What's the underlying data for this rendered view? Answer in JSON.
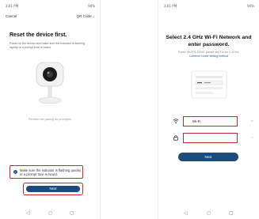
{
  "left_screen": {
    "status": {
      "time": "3:01 PM",
      "indicators": "94%"
    },
    "nav": {
      "cancel": "Cancel",
      "mode": "QR Code",
      "mode_icon": "chevron-down-icon"
    },
    "title": "Reset the device first.",
    "description": "Power on the device and make sure the indicator is flashing rapidly or a prompt tone is heard.",
    "perform_link": "Perform net pairing as prompted",
    "confirm": {
      "checked": true,
      "text": "Make sure the indicator is flashing quickly or a prompt tone is heard."
    },
    "next_label": "Next"
  },
  "right_screen": {
    "status": {
      "time": "3:01 PM",
      "indicators": "94%"
    },
    "title_line1": "Select 2.4 GHz Wi-Fi Network and",
    "title_line2": "enter password.",
    "note": "If your Wi-Fi is 5GHz, please set it to be 2.4GHz.",
    "link": "Common router setting method",
    "ssid": {
      "value": "Wi-Fi",
      "tail": "⇄"
    },
    "password": {
      "value": "",
      "tail": "••"
    },
    "next_label": "Next"
  },
  "system_nav": {
    "back": "◁",
    "home": "○",
    "recents": "▢"
  },
  "colors": {
    "accent_blue": "#1b4b7f",
    "highlight_red": "#c62828"
  }
}
